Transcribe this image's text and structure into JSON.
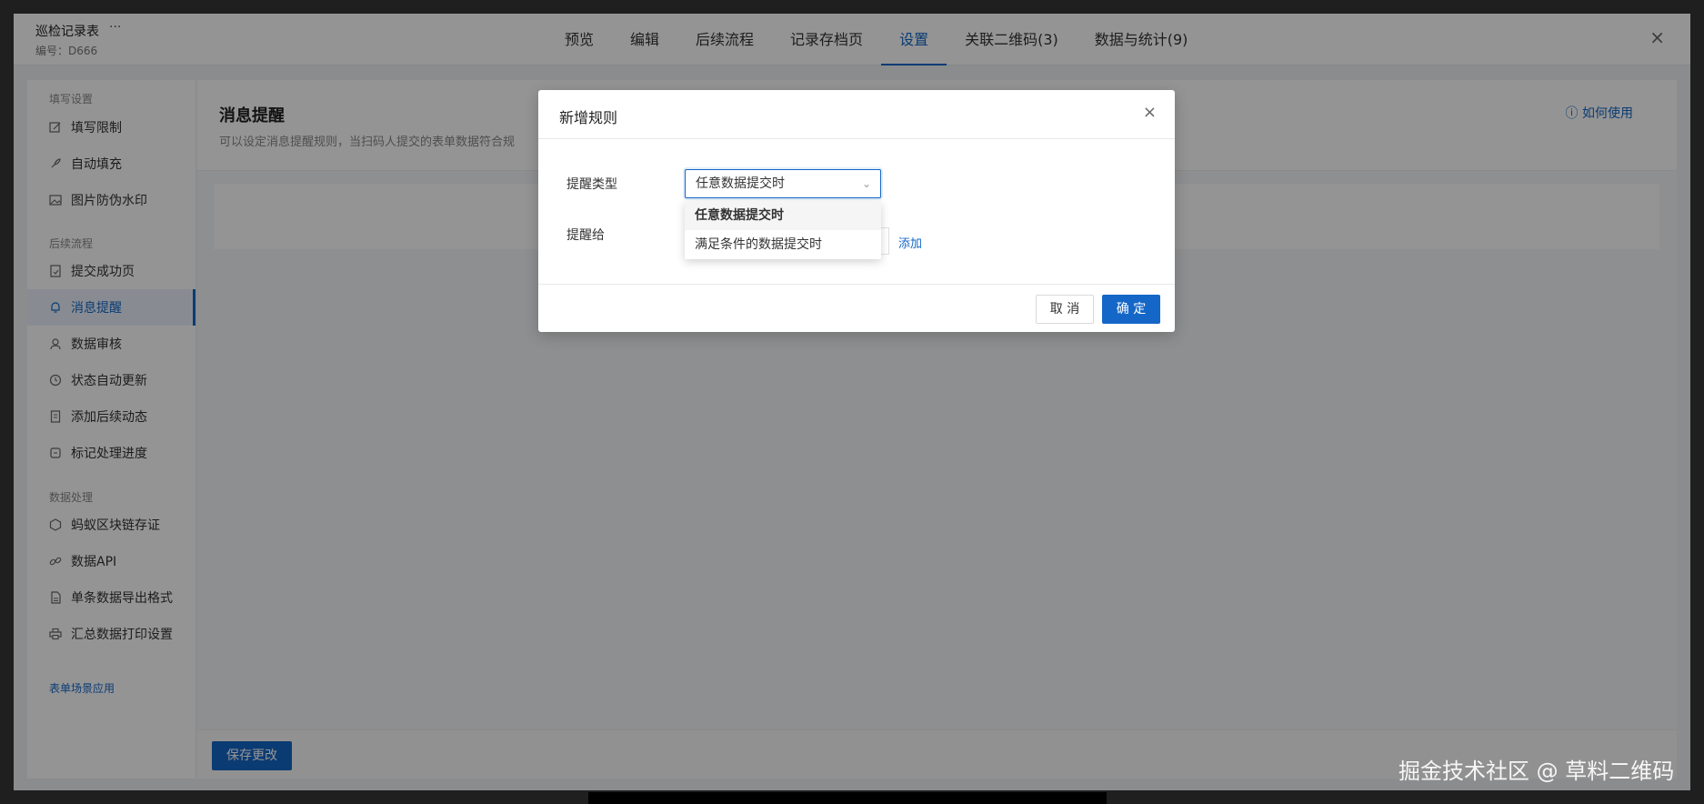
{
  "header": {
    "title": "巡检记录表",
    "more": "···",
    "code": "编号：D666",
    "tabs": [
      {
        "label": "预览"
      },
      {
        "label": "编辑"
      },
      {
        "label": "后续流程"
      },
      {
        "label": "记录存档页"
      },
      {
        "label": "设置"
      },
      {
        "label": "关联二维码(3)"
      },
      {
        "label": "数据与统计(9)"
      }
    ],
    "active_tab": "设置",
    "close": "×"
  },
  "sidebar": {
    "groups": [
      {
        "title": "填写设置",
        "items": [
          {
            "label": "填写限制",
            "icon": "edit-icon"
          },
          {
            "label": "自动填充",
            "icon": "rocket-icon"
          },
          {
            "label": "图片防伪水印",
            "icon": "image-icon"
          }
        ]
      },
      {
        "title": "后续流程",
        "items": [
          {
            "label": "提交成功页",
            "icon": "check-page-icon"
          },
          {
            "label": "消息提醒",
            "icon": "bell-icon"
          },
          {
            "label": "数据审核",
            "icon": "user-icon"
          },
          {
            "label": "状态自动更新",
            "icon": "clock-icon"
          },
          {
            "label": "添加后续动态",
            "icon": "document-icon"
          },
          {
            "label": "标记处理进度",
            "icon": "progress-icon"
          }
        ]
      },
      {
        "title": "数据处理",
        "items": [
          {
            "label": "蚂蚁区块链存证",
            "icon": "blockchain-icon"
          },
          {
            "label": "数据API",
            "icon": "link-icon"
          },
          {
            "label": "单条数据导出格式",
            "icon": "file-icon"
          },
          {
            "label": "汇总数据打印设置",
            "icon": "printer-icon"
          }
        ]
      }
    ],
    "active_item": "消息提醒",
    "scene_link": "表单场景应用"
  },
  "main": {
    "title": "消息提醒",
    "description": "可以设定消息提醒规则，当扫码人提交的表单数据符合规",
    "help": "如何使用",
    "save_button": "保存更改"
  },
  "modal": {
    "title": "新增规则",
    "close": "×",
    "type_label": "提醒类型",
    "selected_value": "任意数据提交时",
    "options": [
      "任意数据提交时",
      "满足条件的数据提交时"
    ],
    "recipient_label": "提醒给",
    "add_link": "添加",
    "cancel": "取 消",
    "ok": "确 定"
  },
  "watermark": "掘金技术社区 @ 草料二维码",
  "colors": {
    "accent": "#1467c7"
  }
}
